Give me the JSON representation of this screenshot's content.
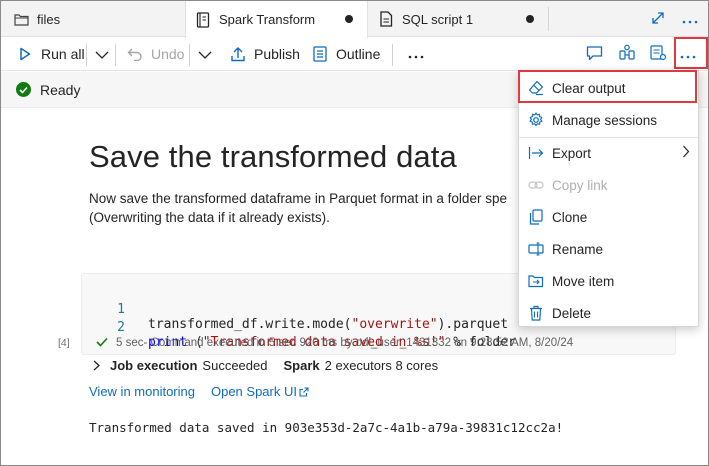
{
  "tabs": [
    {
      "label": "files",
      "icon": "folder-icon",
      "modified": false
    },
    {
      "label": "Spark Transform",
      "icon": "notebook-icon",
      "modified": true
    },
    {
      "label": "SQL script 1",
      "icon": "sql-script-icon",
      "modified": true
    }
  ],
  "toolbar": {
    "run_all": "Run all",
    "undo": "Undo",
    "publish": "Publish",
    "outline": "Outline",
    "more": "···"
  },
  "status": {
    "text": "Ready",
    "color": "#107c10"
  },
  "content": {
    "heading": "Save the transformed data",
    "paragraph_line1": "Now save the transformed dataframe in Parquet format in a folder spe",
    "paragraph_line2": "(Overwriting the data if it already exists).",
    "code": {
      "line1_num": "1",
      "line1_pre": "transformed_df.write.mode(",
      "line1_str": "\"overwrite\"",
      "line1_post": ").parquet",
      "line2_num": "2",
      "line2_kw": "print",
      "line2_mid": " (",
      "line2_str": "\"Transformed data saved in %s!\"",
      "line2_post": " % folder"
    },
    "exec_duration": "5 sec",
    "exec_text": " - Command executed in 5 sec 920 ms by odl_user_1431332 on 9:28:52 AM, 8/20/24",
    "cell_number": "[4]",
    "job_execution_label": "Job execution",
    "job_execution_status": "Succeeded",
    "spark_label": "Spark",
    "spark_info": "2 executors 8 cores",
    "view_monitoring": "View in monitoring",
    "open_spark_ui": "Open Spark UI",
    "output": "Transformed data saved in 903e353d-2a7c-4a1b-a79a-39831c12cc2a!"
  },
  "menu": {
    "items": [
      {
        "label": "Clear output",
        "icon": "clear-output-icon",
        "enabled": true,
        "highlighted": true
      },
      {
        "label": "Manage sessions",
        "icon": "gear-icon",
        "enabled": true
      },
      {
        "label": "Export",
        "icon": "export-icon",
        "enabled": true,
        "submenu": true
      },
      {
        "label": "Copy link",
        "icon": "link-icon",
        "enabled": false
      },
      {
        "label": "Clone",
        "icon": "clone-icon",
        "enabled": true
      },
      {
        "label": "Rename",
        "icon": "rename-icon",
        "enabled": true
      },
      {
        "label": "Move item",
        "icon": "move-icon",
        "enabled": true
      },
      {
        "label": "Delete",
        "icon": "delete-icon",
        "enabled": true
      }
    ]
  },
  "colors": {
    "accent": "#0f6cbd",
    "highlight": "#e03a3e",
    "success": "#107c10"
  }
}
